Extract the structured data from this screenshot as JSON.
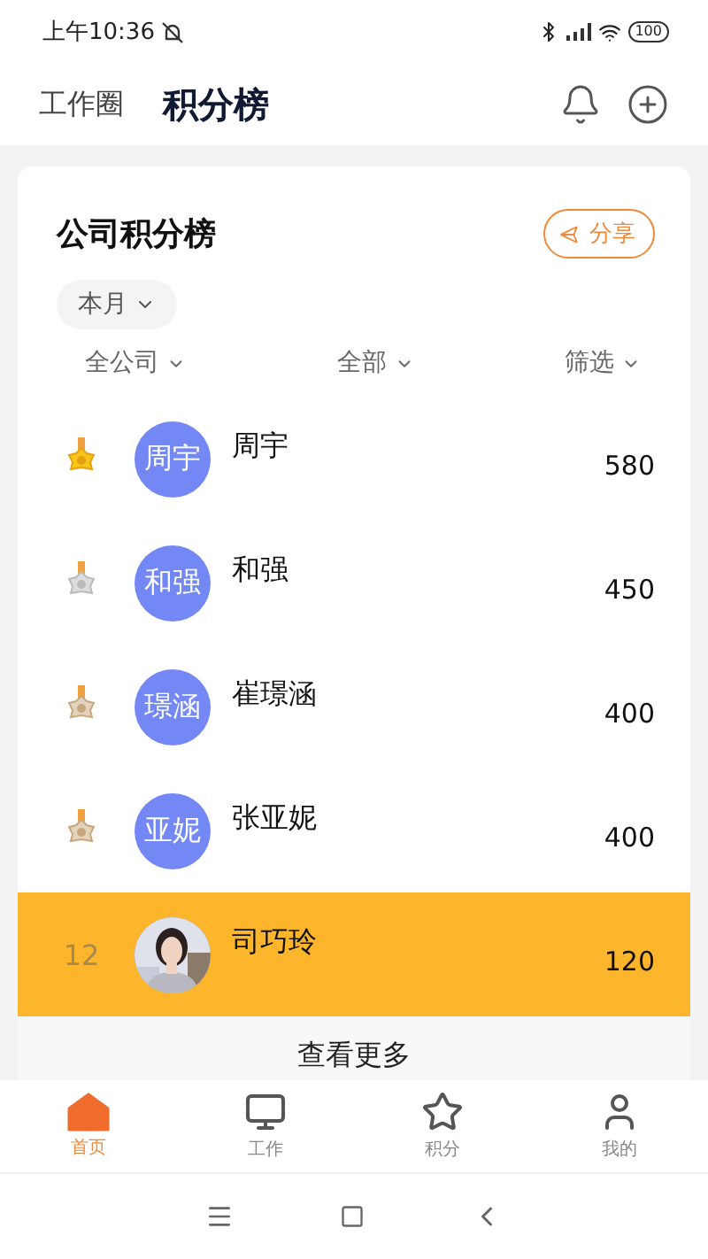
{
  "status_bar": {
    "time": "上午10:36",
    "battery": "100"
  },
  "header": {
    "tabs": [
      {
        "label": "工作圈",
        "selected": false
      },
      {
        "label": "积分榜",
        "selected": true
      }
    ]
  },
  "card": {
    "title": "公司积分榜",
    "share_button": "分享",
    "period": "本月",
    "filters": [
      "全公司",
      "全部",
      "筛选"
    ],
    "rows": [
      {
        "kind": "gold",
        "avatar": {
          "kind": "initials",
          "text": "周宇"
        },
        "name": "周宇",
        "score": "580",
        "highlighted": false
      },
      {
        "kind": "silver",
        "avatar": {
          "kind": "initials",
          "text": "和强"
        },
        "name": "和强",
        "score": "450",
        "highlighted": false
      },
      {
        "kind": "bronze",
        "avatar": {
          "kind": "initials",
          "text": "璟涵"
        },
        "name": "崔璟涵",
        "score": "400",
        "highlighted": false
      },
      {
        "kind": "bronze",
        "avatar": {
          "kind": "initials",
          "text": "亚妮"
        },
        "name": "张亚妮",
        "score": "400",
        "highlighted": false
      },
      {
        "kind": "number",
        "rank": "12",
        "name": "司巧玲",
        "score": "120",
        "highlighted": true
      }
    ],
    "more_link": "查看更多"
  },
  "bottom_nav": [
    {
      "label": "首页",
      "selected": true
    },
    {
      "label": "工作",
      "selected": false
    },
    {
      "label": "积分",
      "selected": false
    },
    {
      "label": "我的",
      "selected": false
    }
  ]
}
